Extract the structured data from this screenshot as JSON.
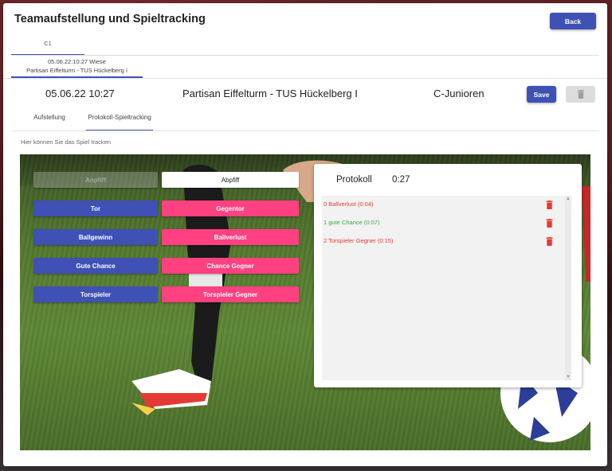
{
  "header": {
    "title": "Teamaufstellung und Spieltracking",
    "back_label": "Back"
  },
  "team_tab": {
    "label": "C1"
  },
  "match_tab": {
    "line1": "05.06.22:10:27 Wiese",
    "line2": "Partisan Eiffelturm - TUS Hückelberg I"
  },
  "match_info": {
    "date": "05.06.22 10:27",
    "teams": "Partisan Eiffelturm - TUS Hückelberg I",
    "class": "C-Junioren",
    "save_label": "Save"
  },
  "tabs": [
    {
      "label": "Aufstellung"
    },
    {
      "label": "Protokoll-Spieltracking"
    }
  ],
  "hint": "Hier können Sie das Spiel tracken",
  "actions": {
    "kickoff": "Anpfiff",
    "end": "Abpfiff",
    "goal": "Tor",
    "goal_against": "Gegentor",
    "ball_win": "Ballgewinn",
    "ball_loss": "Ballverlust",
    "good_chance": "Gute Chance",
    "chance_opponent": "Chance Gegner",
    "shot": "Torspieler",
    "shot_opponent": "Torspieler Gegner"
  },
  "protokoll": {
    "title": "Protokoll",
    "time": "0:27",
    "entries": [
      {
        "text": "0 Ballverlust (0:04)",
        "color": "#e53935"
      },
      {
        "text": "1 gute Chance (0:07)",
        "color": "#43a047"
      },
      {
        "text": "2 Torspieler Gegner (0:15)",
        "color": "#e53935"
      }
    ]
  },
  "icons": {
    "delete": "trash-icon"
  },
  "colors": {
    "primary": "#3f51b5",
    "accent": "#ff4081",
    "danger": "#e53935"
  }
}
